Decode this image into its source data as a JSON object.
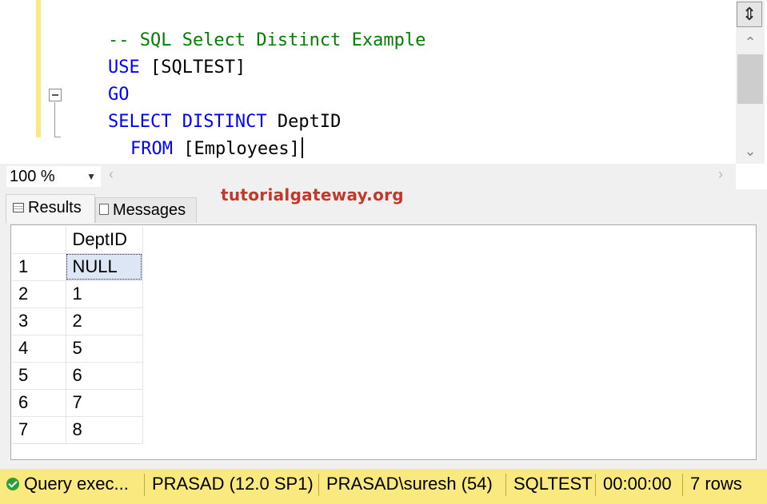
{
  "editor": {
    "lines": [
      {
        "comment": "-- SQL Select Distinct Example"
      },
      {
        "keyword": "USE",
        "text": " [SQLTEST]"
      },
      {
        "keyword": "GO"
      },
      {
        "keyword": "SELECT DISTINCT",
        "text": " DeptID"
      },
      {
        "keyword": "FROM",
        "text": " [Employees]"
      }
    ]
  },
  "zoom": {
    "value": "100 %"
  },
  "tabs": {
    "results": "Results",
    "messages": "Messages"
  },
  "watermark": "tutorialgateway.org",
  "grid": {
    "column": "DeptID",
    "rows": [
      {
        "n": "1",
        "v": "NULL"
      },
      {
        "n": "2",
        "v": "1"
      },
      {
        "n": "3",
        "v": "2"
      },
      {
        "n": "4",
        "v": "5"
      },
      {
        "n": "5",
        "v": "6"
      },
      {
        "n": "6",
        "v": "7"
      },
      {
        "n": "7",
        "v": "8"
      }
    ]
  },
  "status": {
    "query": "Query exec...",
    "server": "PRASAD (12.0 SP1)",
    "user": "PRASAD\\suresh (54)",
    "database": "SQLTEST",
    "time": "00:00:00",
    "rows": "7 rows"
  },
  "colors": {
    "keyword": "#0000ff",
    "comment": "#008000",
    "status_bar": "#f9e97f",
    "change_bar": "#f9e97f"
  }
}
